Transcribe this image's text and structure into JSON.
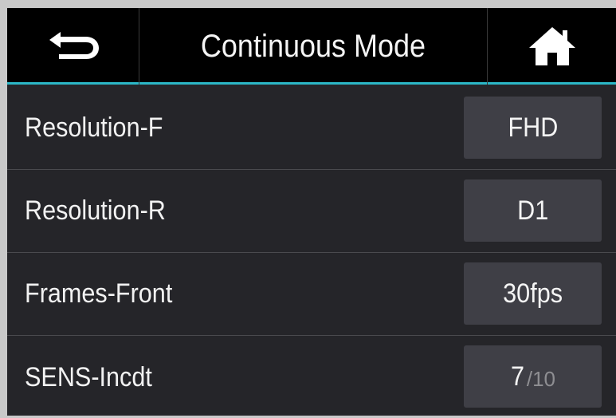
{
  "header": {
    "title": "Continuous Mode",
    "back_icon": "back-arrow-icon",
    "home_icon": "home-icon"
  },
  "settings": [
    {
      "label": "Resolution-F",
      "value": "FHD"
    },
    {
      "label": "Resolution-R",
      "value": "D1"
    },
    {
      "label": "Frames-Front",
      "value": "30fps"
    },
    {
      "label": "SENS-Incdt",
      "value": "7",
      "value_max": "/10"
    }
  ],
  "colors": {
    "accent": "#2bb7c7",
    "background": "#252529",
    "header": "#000000",
    "button": "#3f3f46"
  }
}
